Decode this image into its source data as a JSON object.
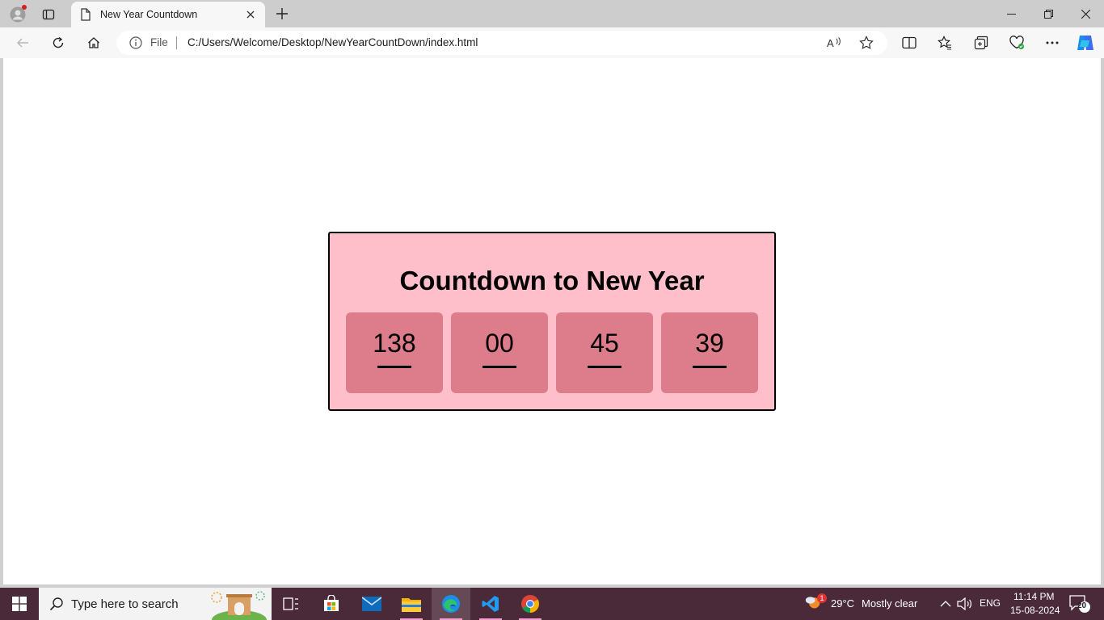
{
  "browser": {
    "tab": {
      "title": "New Year Countdown"
    },
    "address": {
      "scheme_label": "File",
      "url": "C:/Users/Welcome/Desktop/NewYearCountDown/index.html"
    }
  },
  "page": {
    "heading": "Countdown to New Year",
    "countdown": [
      {
        "value": "138"
      },
      {
        "value": "00"
      },
      {
        "value": "45"
      },
      {
        "value": "39"
      }
    ],
    "colors": {
      "card_bg": "#ffbfca",
      "unit_bg": "#dd7c8a",
      "border": "#000000"
    }
  },
  "taskbar": {
    "search_placeholder": "Type here to search",
    "weather": {
      "temp": "29°C",
      "condition": "Mostly clear",
      "badge": "1"
    },
    "language": "ENG",
    "time": "11:14 PM",
    "date": "15-08-2024",
    "notifications": "20",
    "accent": "#4a2a38"
  }
}
